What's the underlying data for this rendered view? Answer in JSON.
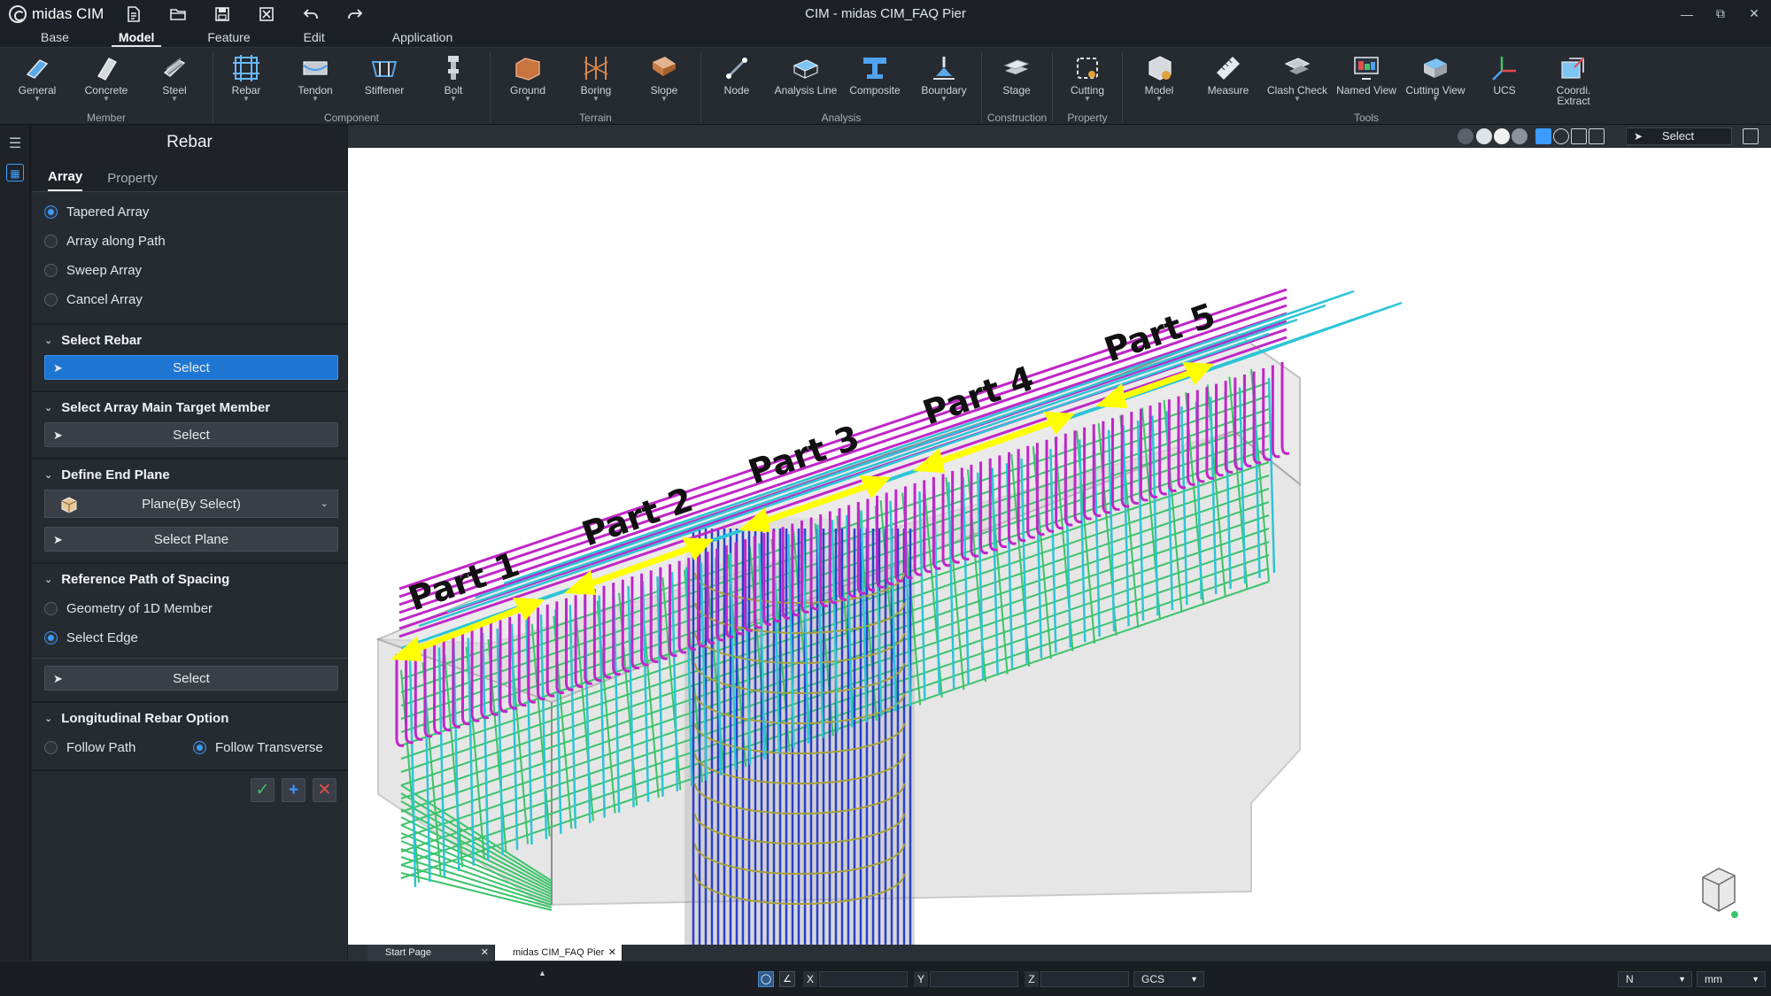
{
  "app": {
    "logo_text": "midas CIM",
    "window_title": "CIM - midas CIM_FAQ Pier"
  },
  "quick_access": [
    {
      "icon": "new-file-icon"
    },
    {
      "icon": "open-folder-icon"
    },
    {
      "icon": "save-icon"
    },
    {
      "icon": "close-file-icon"
    },
    {
      "icon": "undo-icon"
    },
    {
      "icon": "redo-icon"
    }
  ],
  "menu_tabs": [
    {
      "label": "Base",
      "active": false
    },
    {
      "label": "Model",
      "active": true
    },
    {
      "label": "Feature",
      "active": false
    },
    {
      "label": "Edit",
      "active": false
    },
    {
      "label": "Application",
      "active": false
    }
  ],
  "ribbon": {
    "groups": {
      "member": "Member",
      "component": "Component",
      "terrain": "Terrain",
      "analysis": "Analysis",
      "construction": "Construction",
      "property": "Property",
      "tools": "Tools"
    },
    "buttons": {
      "general": "General",
      "concrete": "Concrete",
      "steel": "Steel",
      "rebar": "Rebar",
      "tendon": "Tendon",
      "stiffener": "Stiffener",
      "bolt": "Bolt",
      "ground": "Ground",
      "boring": "Boring",
      "slope": "Slope",
      "node": "Node",
      "analysis_line": "Analysis Line",
      "composite": "Composite",
      "boundary": "Boundary",
      "stage": "Stage",
      "cutting": "Cutting",
      "model": "Model",
      "measure": "Measure",
      "clash_check": "Clash Check",
      "named_view": "Named View",
      "cutting_view": "Cutting View",
      "ucs": "UCS",
      "coordi_extract_1": "Coordi.",
      "coordi_extract_2": "Extract"
    }
  },
  "panel": {
    "title": "Rebar",
    "tabs": {
      "array": "Array",
      "property": "Property"
    },
    "array_types": [
      "Tapered Array",
      "Array along Path",
      "Sweep Array",
      "Cancel Array"
    ],
    "array_selected": "Tapered Array",
    "select_rebar": {
      "header": "Select Rebar",
      "button": "Select"
    },
    "select_target": {
      "header": "Select Array Main Target Member",
      "button": "Select"
    },
    "end_plane": {
      "header": "Define End Plane",
      "dropdown": "Plane(By Select)",
      "button": "Select Plane"
    },
    "ref_path": {
      "header": "Reference Path of Spacing",
      "options": [
        "Geometry of 1D Member",
        "Select Edge"
      ],
      "selected": "Select Edge",
      "button": "Select"
    },
    "longitudinal": {
      "header": "Longitudinal Rebar Option",
      "options": [
        "Follow Path",
        "Follow Transverse"
      ],
      "selected": "Follow Transverse"
    }
  },
  "viewport": {
    "toolbar_select": "Select",
    "annotations": [
      "Part 1",
      "Part 2",
      "Part 3",
      "Part 4",
      "Part 5"
    ],
    "colors": {
      "concrete": "#c9c9c9",
      "stirrups_magenta": "#c026c8",
      "rebar_cyan": "#2ec4d6",
      "mesh_green": "#3cc36a",
      "column_blue": "#2a3fd0",
      "hoop_olive": "#a9a03a",
      "arrow_yellow": "#ffff00"
    }
  },
  "doc_tabs": [
    {
      "label": "Start Page",
      "active": false
    },
    {
      "label": "midas CIM_FAQ Pier",
      "active": true
    }
  ],
  "status": {
    "x_label": "X",
    "y_label": "Y",
    "z_label": "Z",
    "x_value": "",
    "y_value": "",
    "z_value": "",
    "coord_system": "GCS",
    "force_unit": "N",
    "length_unit": "mm"
  }
}
